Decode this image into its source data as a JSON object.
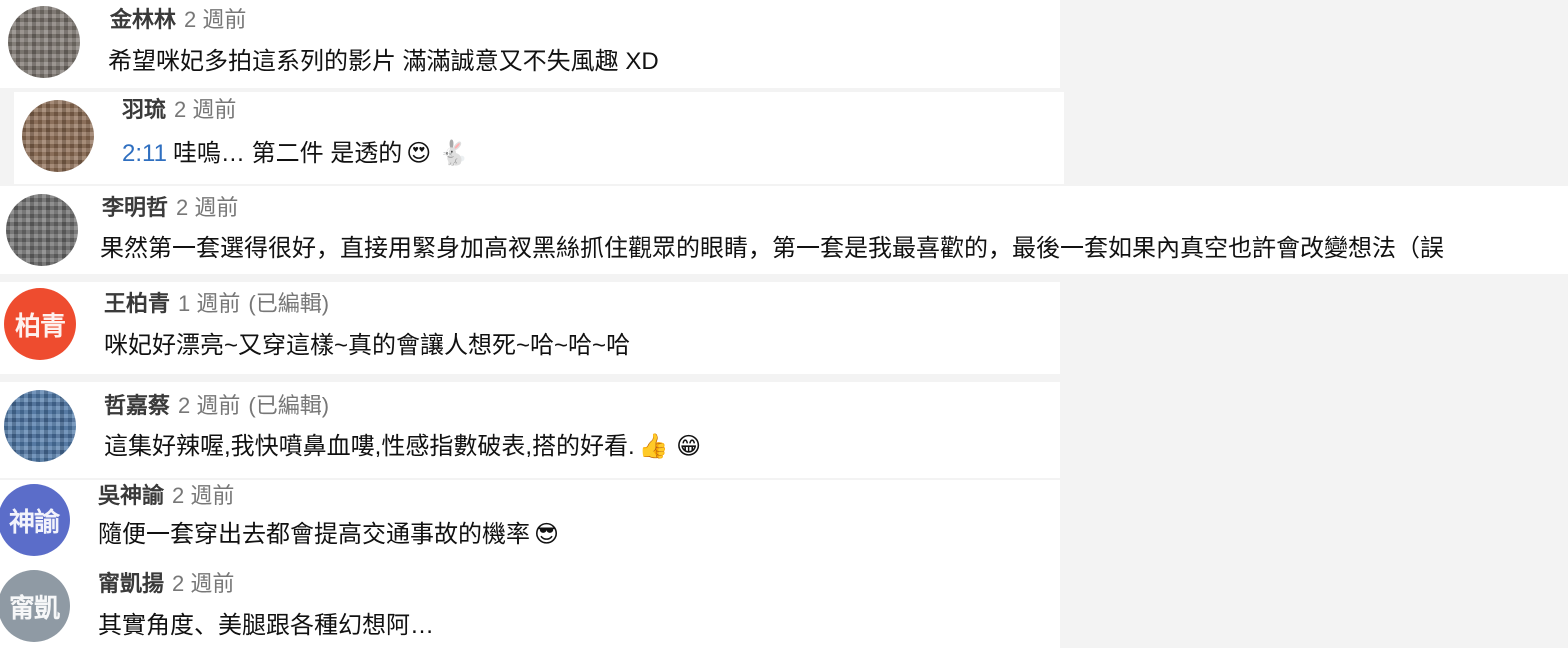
{
  "comments": [
    {
      "author": "金林林",
      "time": "2 週前",
      "edited": "",
      "text": "希望咪妃多拍這系列的影片 滿滿誠意又不失風趣 XD",
      "emoji": "",
      "avatar_label": ""
    },
    {
      "author": "羽琉",
      "time": "2 週前",
      "edited": "",
      "timestamp": "2:11",
      "text": "哇嗚… 第二件 是透的",
      "emoji": "😍 🐇",
      "avatar_label": ""
    },
    {
      "author": "李明哲",
      "time": "2 週前",
      "edited": "",
      "text": "果然第一套選得很好，直接用緊身加高衩黑絲抓住觀眾的眼睛，第一套是我最喜歡的，最後一套如果內真空也許會改變想法（誤",
      "emoji": "",
      "avatar_label": ""
    },
    {
      "author": "王柏青",
      "time": "1 週前",
      "edited": "(已編輯)",
      "text": "咪妃好漂亮~又穿這樣~真的會讓人想死~哈~哈~哈",
      "emoji": "",
      "avatar_label": "柏青"
    },
    {
      "author": "哲嘉蔡",
      "time": "2 週前",
      "edited": "(已編輯)",
      "text": "這集好辣喔,我快噴鼻血嘍,性感指數破表,搭的好看.",
      "emoji": "👍 😁",
      "avatar_label": ""
    },
    {
      "author": "吳神諭",
      "time": "2 週前",
      "edited": "",
      "text": "隨便一套穿出去都會提高交通事故的機率",
      "emoji": "😎",
      "avatar_label": "神諭"
    },
    {
      "author": "甯凱揚",
      "time": "2 週前",
      "edited": "",
      "text": "其實角度、美腿跟各種幻想阿…",
      "emoji": "",
      "avatar_label": "甯凱"
    }
  ]
}
